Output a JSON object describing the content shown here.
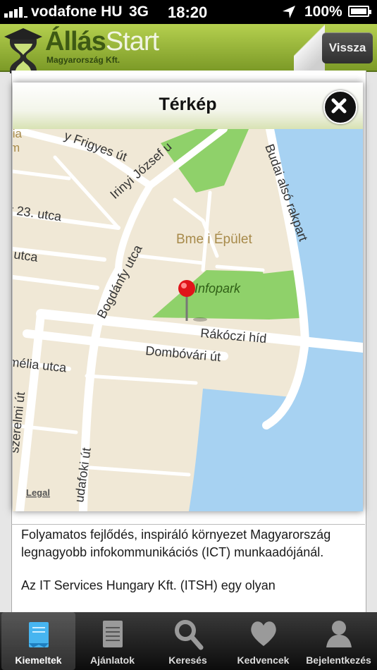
{
  "status": {
    "carrier": "vodafone HU",
    "network": "3G",
    "time": "18:20",
    "battery": "100%"
  },
  "header": {
    "brand_main": "Állás",
    "brand_second": "Start",
    "brand_sub": "Magyarország Kft.",
    "back_label": "Vissza"
  },
  "modal": {
    "title": "Térkép"
  },
  "map": {
    "labels": {
      "frigyes": "y Frigyes út",
      "irinyi": "Irinyi József u",
      "budai": "Budai alsó rakpart",
      "okt23": "r 23. utca",
      "bogdanfy": "Bogdánfy utca",
      "bme": "Bme i Épület",
      "infopark": "Infopark",
      "utca": "i utca",
      "rakoczi": "Rákóczi híd",
      "dombovari": "Dombóvári út",
      "melia": "mélia utca",
      "budafoki": "udafoki út",
      "szerelmi": "szerelmi út",
      "lia": "lia",
      "m": "m"
    },
    "legal": "Legal",
    "colors": {
      "land": "#f0e8d6",
      "water": "#a7d2f2",
      "park": "#8fd16a",
      "road": "#ffffff",
      "pin": "#e0141a"
    }
  },
  "body_text": [
    "Folyamatos fejlődés, inspiráló környezet Magyarország legnagyobb infokommunikációs (ICT) munkaadójánál.",
    "Az IT Services Hungary Kft. (ITSH) egy olyan"
  ],
  "tabs": [
    {
      "label": "Kiemeltek",
      "icon": "bookmark-icon",
      "active": true
    },
    {
      "label": "Ajánlatok",
      "icon": "notepad-icon",
      "active": false
    },
    {
      "label": "Keresés",
      "icon": "search-icon",
      "active": false
    },
    {
      "label": "Kedvencek",
      "icon": "heart-icon",
      "active": false
    },
    {
      "label": "Bejelentkezés",
      "icon": "user-icon",
      "active": false
    }
  ]
}
